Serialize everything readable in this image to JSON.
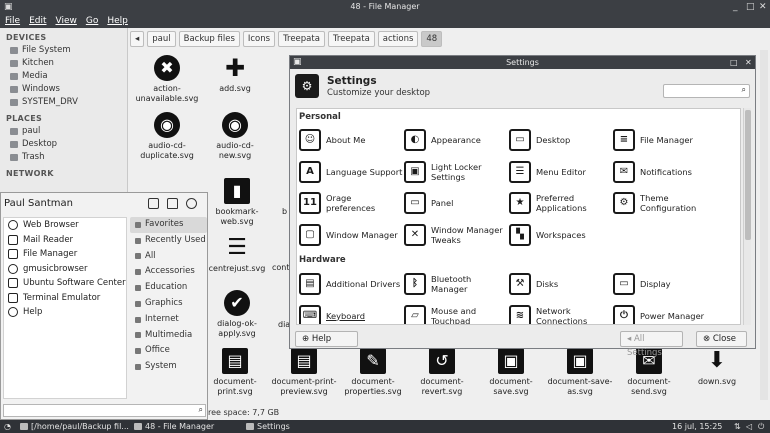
{
  "fm": {
    "title": "48 - File Manager",
    "menu": [
      "File",
      "Edit",
      "View",
      "Go",
      "Help"
    ],
    "sidebar": {
      "devices_header": "DEVICES",
      "devices": [
        "File System",
        "Kitchen",
        "Media",
        "Windows",
        "SYSTEM_DRV"
      ],
      "places_header": "PLACES",
      "places": [
        "paul",
        "Desktop",
        "Trash"
      ],
      "network_header": "NETWORK"
    },
    "crumbs": [
      "paul",
      "Backup files",
      "Icons",
      "Treepata",
      "Treepata",
      "actions",
      "48"
    ],
    "files": [
      {
        "name": "action-\nunavailable.svg",
        "glyph": "✖"
      },
      {
        "name": "add.svg",
        "glyph": "✚"
      },
      {
        "name": "audio-cd-\nduplicate.svg",
        "glyph": "◉"
      },
      {
        "name": "audio-cd-\nnew.svg",
        "glyph": "◉"
      },
      {
        "name": "bookmark-\nweb.svg",
        "glyph": "▮"
      },
      {
        "name": "centrejust.svg",
        "glyph": "☰"
      },
      {
        "name": "dialog-ok-\napply.svg",
        "glyph": "✔"
      },
      {
        "name": "document-\nprint.svg",
        "glyph": "▤"
      },
      {
        "name": "document-print-\npreview.svg",
        "glyph": "▤"
      },
      {
        "name": "document-\nproperties.svg",
        "glyph": "✎"
      },
      {
        "name": "document-\nrevert.svg",
        "glyph": "↺"
      },
      {
        "name": "document-\nsave.svg",
        "glyph": "▣"
      },
      {
        "name": "document-save-\nas.svg",
        "glyph": "▣"
      },
      {
        "name": "document-\nsend.svg",
        "glyph": "✉"
      },
      {
        "name": "down.svg",
        "glyph": "⬇"
      }
    ],
    "partial_labels": [
      "b",
      "cont",
      "dia"
    ],
    "status": "ree space: 7,7 GB"
  },
  "start_menu": {
    "user": "Paul Santman",
    "apps": [
      "Web Browser",
      "Mail Reader",
      "File Manager",
      "gmusicbrowser",
      "Ubuntu Software Center",
      "Terminal Emulator",
      "Help"
    ],
    "categories": [
      "Favorites",
      "Recently Used",
      "All",
      "Accessories",
      "Education",
      "Graphics",
      "Internet",
      "Multimedia",
      "Office",
      "System"
    ],
    "search_placeholder": ""
  },
  "settings": {
    "window_title": "Settings",
    "heading": "Settings",
    "subheading": "Customize your desktop",
    "sections": {
      "personal": "Personal",
      "hardware": "Hardware"
    },
    "personal": [
      {
        "label": "About Me",
        "glyph": "☺"
      },
      {
        "label": "Appearance",
        "glyph": "◐"
      },
      {
        "label": "Desktop",
        "glyph": "▭"
      },
      {
        "label": "File Manager",
        "glyph": "≡"
      },
      {
        "label": "Language Support",
        "glyph": "A"
      },
      {
        "label": "Light Locker\nSettings",
        "glyph": "▣"
      },
      {
        "label": "Menu Editor",
        "glyph": "☰"
      },
      {
        "label": "Notifications",
        "glyph": "✉"
      },
      {
        "label": "Orage preferences",
        "glyph": "11"
      },
      {
        "label": "Panel",
        "glyph": "▭"
      },
      {
        "label": "Preferred\nApplications",
        "glyph": "★"
      },
      {
        "label": "Theme\nConfiguration",
        "glyph": "⚙"
      },
      {
        "label": "Window Manager",
        "glyph": "▢"
      },
      {
        "label": "Window Manager\nTweaks",
        "glyph": "✕"
      },
      {
        "label": "Workspaces",
        "glyph": "▚"
      }
    ],
    "hardware": [
      {
        "label": "Additional Drivers",
        "glyph": "▤"
      },
      {
        "label": "Bluetooth\nManager",
        "glyph": "ᛒ"
      },
      {
        "label": "Disks",
        "glyph": "⚒"
      },
      {
        "label": "Display",
        "glyph": "▭"
      },
      {
        "label": "Keyboard",
        "glyph": "⌨"
      },
      {
        "label": "Mouse and\nTouchpad",
        "glyph": "▱"
      },
      {
        "label": "Network\nConnections",
        "glyph": "≋"
      },
      {
        "label": "Power Manager",
        "glyph": "⏻"
      }
    ],
    "buttons": {
      "help": "Help",
      "all_settings": "All Settings",
      "close": "Close"
    }
  },
  "taskbar": {
    "items": [
      "[/home/paul/Backup fil...",
      "48 - File Manager",
      "Settings"
    ],
    "clock": "16 jul, 15:25"
  }
}
